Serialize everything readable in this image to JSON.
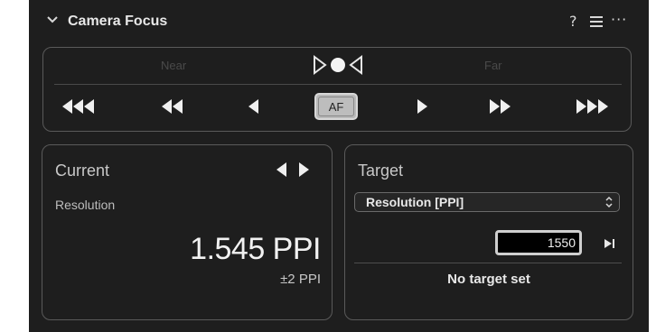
{
  "header": {
    "title": "Camera Focus",
    "help_label": "?",
    "more_label": "···"
  },
  "focus": {
    "near_label": "Near",
    "far_label": "Far",
    "af_label": "AF",
    "buttons": [
      "focus-near-large-icon",
      "focus-near-medium-icon",
      "focus-near-small-icon",
      "focus-far-small-icon",
      "focus-far-medium-icon",
      "focus-far-large-icon"
    ]
  },
  "current": {
    "title": "Current",
    "resolution_label": "Resolution",
    "value": "1.545 PPI",
    "tolerance": "±2 PPI"
  },
  "target": {
    "title": "Target",
    "select_value": "Resolution [PPI]",
    "input_value": "1550",
    "status": "No target set"
  },
  "colors": {
    "panel_bg": "#1e1e1e",
    "border": "#5a5a5a",
    "text": "#e6e6e6",
    "af_button": "#bdbdbd"
  }
}
